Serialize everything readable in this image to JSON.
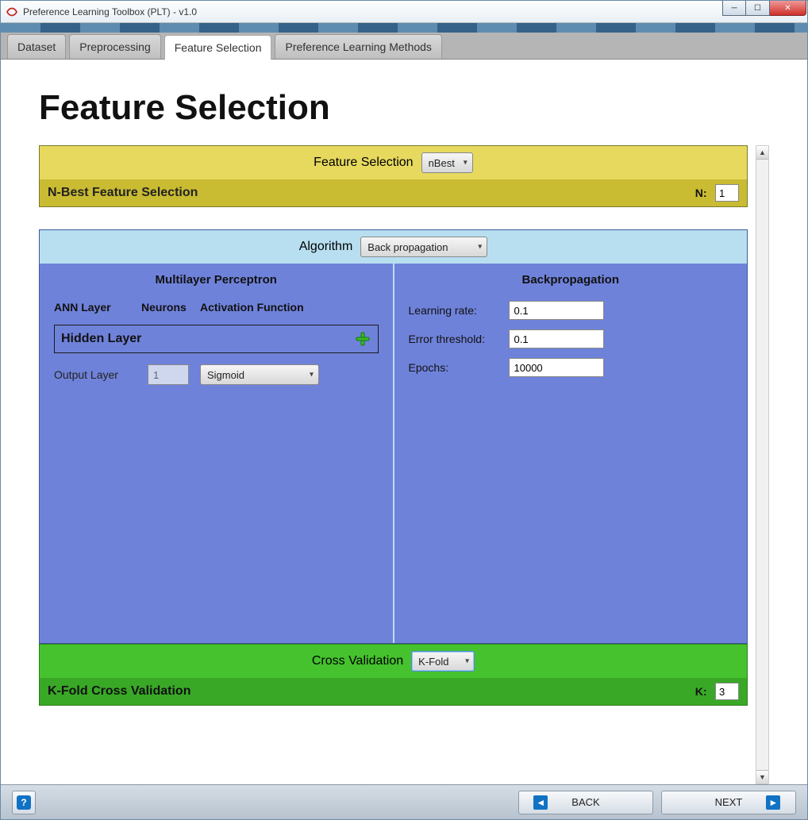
{
  "window": {
    "title": "Preference Learning Toolbox (PLT) - v1.0"
  },
  "tabs": [
    {
      "label": "Dataset"
    },
    {
      "label": "Preprocessing"
    },
    {
      "label": "Feature Selection",
      "active": true
    },
    {
      "label": "Preference Learning Methods"
    }
  ],
  "page": {
    "heading": "Feature Selection"
  },
  "feature_selection": {
    "label": "Feature Selection",
    "selected": "nBest",
    "bar_title": "N-Best Feature Selection",
    "n_label": "N:",
    "n_value": "1"
  },
  "algorithm": {
    "label": "Algorithm",
    "selected": "Back propagation",
    "left": {
      "title": "Multilayer Perceptron",
      "headers": {
        "c1": "ANN Layer",
        "c2": "Neurons",
        "c3": "Activation Function"
      },
      "hidden_label": "Hidden Layer",
      "output_label": "Output Layer",
      "output_neurons": "1",
      "output_activation": "Sigmoid"
    },
    "right": {
      "title": "Backpropagation",
      "learning_rate_label": "Learning rate:",
      "learning_rate": "0.1",
      "error_threshold_label": "Error threshold:",
      "error_threshold": "0.1",
      "epochs_label": "Epochs:",
      "epochs": "10000"
    }
  },
  "cross_validation": {
    "label": "Cross Validation",
    "selected": "K-Fold",
    "bar_title": "K-Fold Cross Validation",
    "k_label": "K:",
    "k_value": "3"
  },
  "footer": {
    "back": "BACK",
    "next": "NEXT"
  }
}
